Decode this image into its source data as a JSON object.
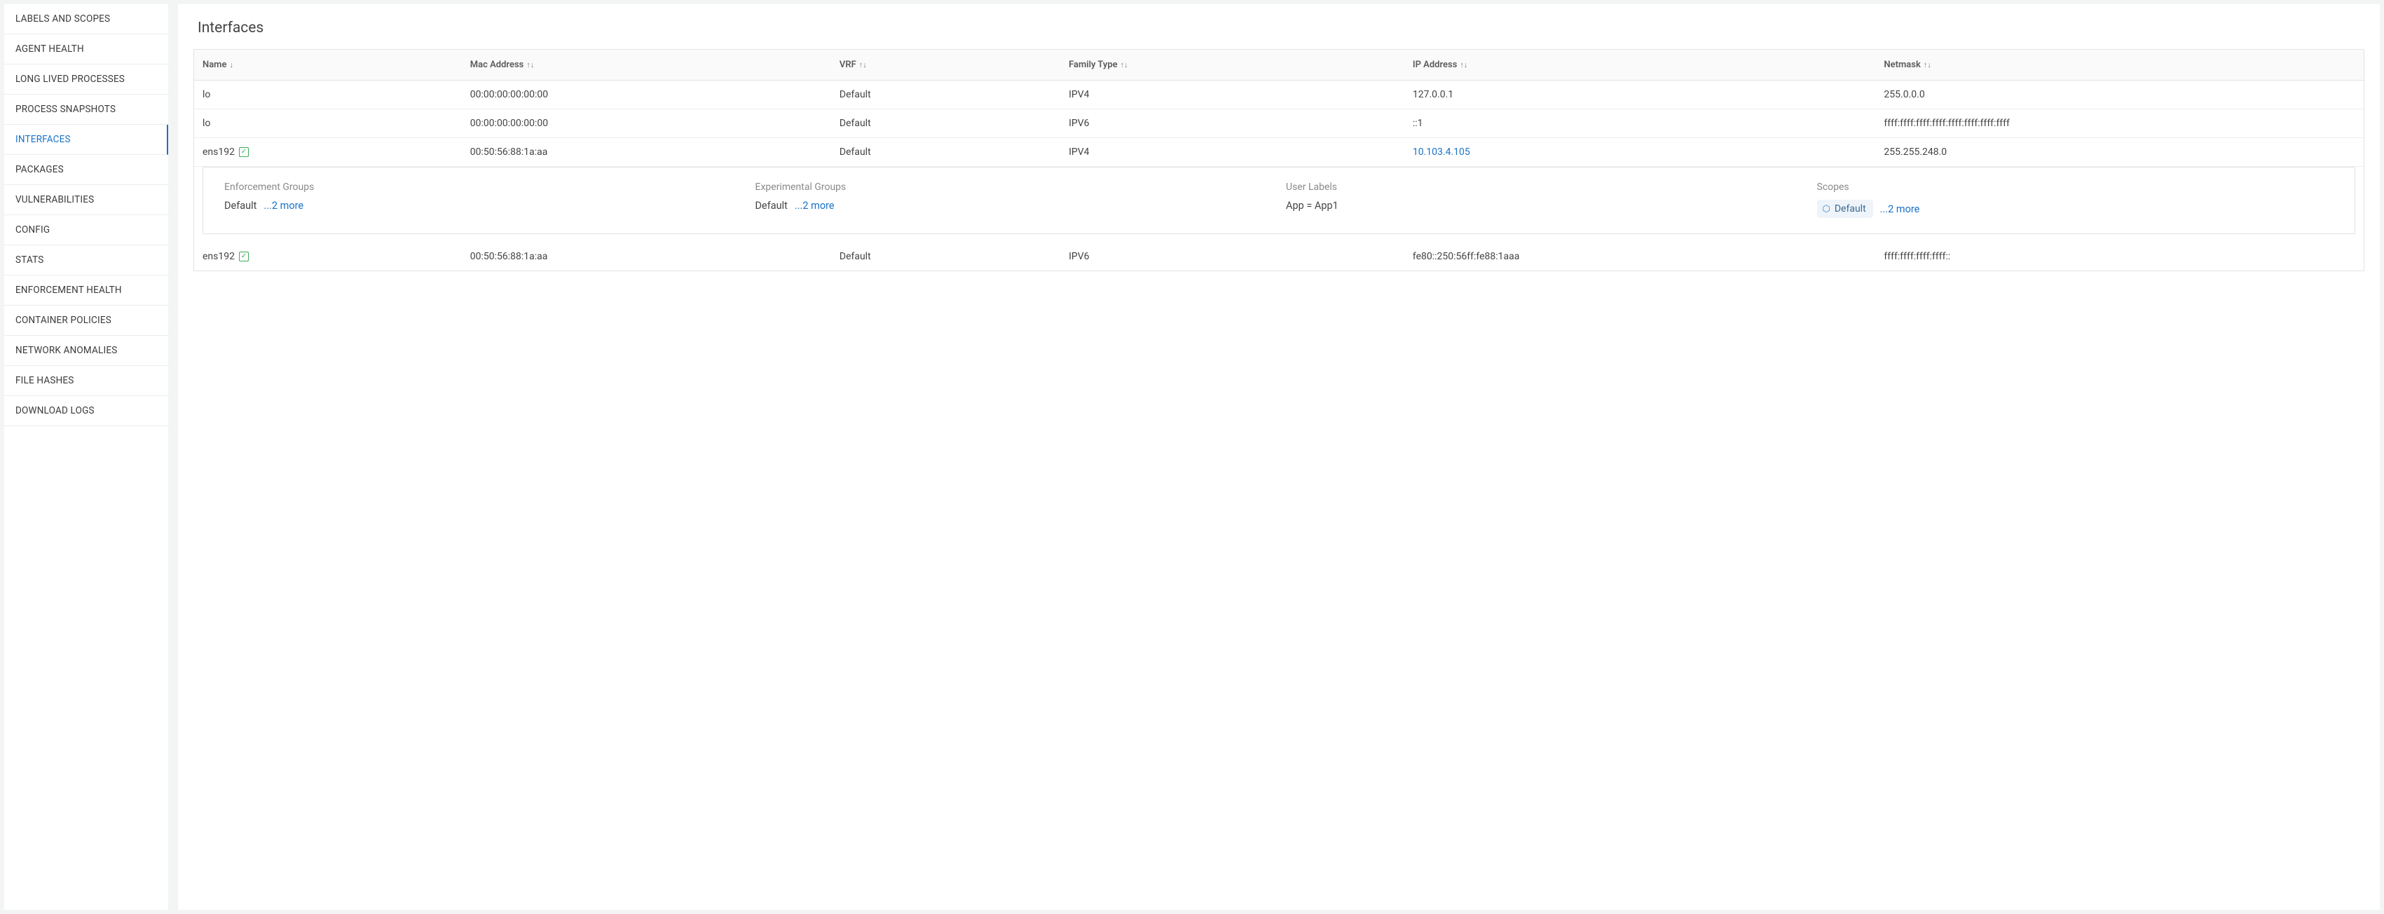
{
  "sidebar": {
    "items": [
      {
        "label": "LABELS AND SCOPES",
        "id": "labels-and-scopes"
      },
      {
        "label": "AGENT HEALTH",
        "id": "agent-health"
      },
      {
        "label": "LONG LIVED PROCESSES",
        "id": "long-lived-processes"
      },
      {
        "label": "PROCESS SNAPSHOTS",
        "id": "process-snapshots"
      },
      {
        "label": "INTERFACES",
        "id": "interfaces",
        "active": true
      },
      {
        "label": "PACKAGES",
        "id": "packages"
      },
      {
        "label": "VULNERABILITIES",
        "id": "vulnerabilities"
      },
      {
        "label": "CONFIG",
        "id": "config"
      },
      {
        "label": "STATS",
        "id": "stats"
      },
      {
        "label": "ENFORCEMENT HEALTH",
        "id": "enforcement-health"
      },
      {
        "label": "CONTAINER POLICIES",
        "id": "container-policies"
      },
      {
        "label": "NETWORK ANOMALIES",
        "id": "network-anomalies"
      },
      {
        "label": "FILE HASHES",
        "id": "file-hashes"
      },
      {
        "label": "DOWNLOAD LOGS",
        "id": "download-logs"
      }
    ]
  },
  "page": {
    "title": "Interfaces"
  },
  "table": {
    "columns": {
      "name": {
        "label": "Name",
        "sort": "down"
      },
      "mac": {
        "label": "Mac Address",
        "sort": "both"
      },
      "vrf": {
        "label": "VRF",
        "sort": "both"
      },
      "family": {
        "label": "Family Type",
        "sort": "both"
      },
      "ip": {
        "label": "IP Address",
        "sort": "both"
      },
      "netmask": {
        "label": "Netmask",
        "sort": "both"
      }
    },
    "rows": [
      {
        "name": "lo",
        "check": false,
        "mac": "00:00:00:00:00:00",
        "vrf": "Default",
        "family": "IPV4",
        "ip": "127.0.0.1",
        "ip_link": false,
        "netmask": "255.0.0.0"
      },
      {
        "name": "lo",
        "check": false,
        "mac": "00:00:00:00:00:00",
        "vrf": "Default",
        "family": "IPV6",
        "ip": "::1",
        "ip_link": false,
        "netmask": "ffff:ffff:ffff:ffff:ffff:ffff:ffff:ffff"
      },
      {
        "name": "ens192",
        "check": true,
        "mac": "00:50:56:88:1a:aa",
        "vrf": "Default",
        "family": "IPV4",
        "ip": "10.103.4.105",
        "ip_link": true,
        "netmask": "255.255.248.0"
      },
      {
        "name": "ens192",
        "check": true,
        "mac": "00:50:56:88:1a:aa",
        "vrf": "Default",
        "family": "IPV6",
        "ip": "fe80::250:56ff:fe88:1aaa",
        "ip_link": false,
        "netmask": "ffff:ffff:ffff:ffff::"
      }
    ]
  },
  "detail": {
    "enforcement_groups": {
      "heading": "Enforcement Groups",
      "value": "Default",
      "more": "...2 more"
    },
    "experimental_groups": {
      "heading": "Experimental Groups",
      "value": "Default",
      "more": "...2 more"
    },
    "user_labels": {
      "heading": "User Labels",
      "value": "App = App1"
    },
    "scopes": {
      "heading": "Scopes",
      "chip": "Default",
      "more": "...2 more"
    }
  }
}
